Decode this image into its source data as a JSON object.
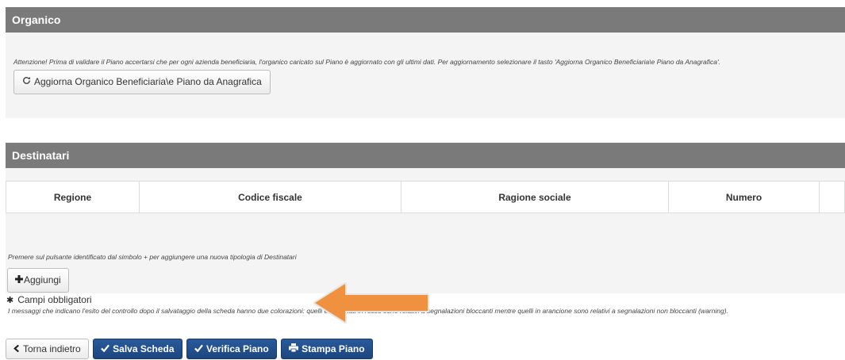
{
  "organico": {
    "title": "Organico",
    "note": "Attenzione! Prima di validare il Piano accertarsi che per ogni azienda beneficiaria, l'organico caricato sul Piano è aggiornato con gli ultimi dati. Per aggiornamento selezionare il tasto 'Aggiorna Organico Beneficiaria\\e Piano da Anagrafica'.",
    "refresh_button": "Aggiorna Organico Beneficiaria\\e Piano da Anagrafica"
  },
  "destinatari": {
    "title": "Destinatari",
    "columns": [
      "Regione",
      "Codice fiscale",
      "Ragione sociale",
      "Numero",
      ""
    ],
    "note": "Premere sul pulsante identificato dal simbolo + per aggiungere una nuova tipologia di Destinatari",
    "add_button": "Aggiungi"
  },
  "required_fields": "Campi obbligatori",
  "messages_note": "I messaggi che indicano l'esito del controllo dopo il salvataggio della scheda hanno due colorazioni: quelli evidenziati in rosso sono relativi a segnalazioni bloccanti mentre quelli in arancione sono relativi a segnalazioni non bloccanti (warning).",
  "actions": {
    "back": "Torna indietro",
    "save": "Salva Scheda",
    "verify": "Verifica Piano",
    "print": "Stampa Piano"
  },
  "colors": {
    "panel_header": "#7a7a7a",
    "primary_button": "#1c4680",
    "arrow": "#f0913f"
  },
  "icons": [
    "refresh-icon",
    "plus-icon",
    "asterisk-icon",
    "chevron-left-icon",
    "check-icon",
    "print-icon",
    "arrow-icon"
  ]
}
